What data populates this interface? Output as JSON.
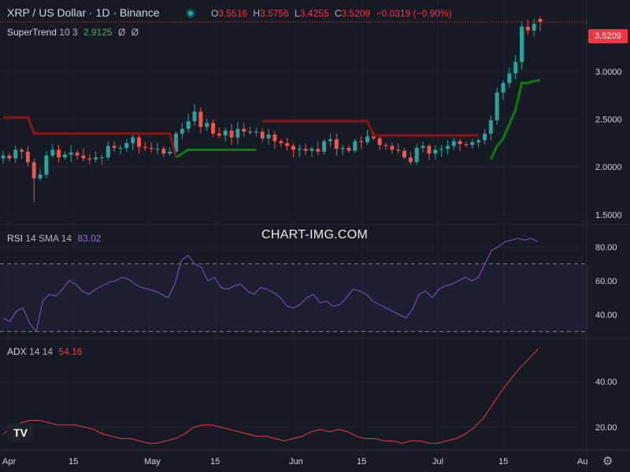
{
  "header": {
    "symbol": "XRP / US Dollar · 1D · Binance",
    "open_label": "O",
    "open": "3.5516",
    "high_label": "H",
    "high": "3.5756",
    "low_label": "L",
    "low": "3.4255",
    "close_label": "C",
    "close": "3.5209",
    "change": "−0.0319 (−0.90%)"
  },
  "supertrend": {
    "label": "SuperTrend",
    "params": "10 3",
    "value": "2.9125"
  },
  "rsi": {
    "label": "RSI",
    "params": "14 SMA 14",
    "value": "83.02"
  },
  "adx": {
    "label": "ADX",
    "params": "14 14",
    "value": "54.16"
  },
  "watermark": "CHART-IMG.COM",
  "price_tag": "3.5209",
  "colors": {
    "up": "#26a69a",
    "down": "#ef5350",
    "supertrend_up": "#087f0c",
    "supertrend_down": "#8e1313",
    "rsi": "#7e57c2",
    "adx": "#f23645",
    "background": "#161a25"
  },
  "chart_data": [
    {
      "type": "candlestick",
      "title": "XRP / US Dollar · 1D · Binance",
      "ylim": [
        1.4,
        3.75
      ],
      "yticks": [
        "1.5000",
        "2.0000",
        "2.5000",
        "3.0000"
      ],
      "xticks": [
        "Apr",
        "15",
        "May",
        "15",
        "Jun",
        "15",
        "Jul",
        "15",
        "Au"
      ],
      "approx_close": [
        2.12,
        2.09,
        2.18,
        2.16,
        2.05,
        1.88,
        1.92,
        2.12,
        2.18,
        2.1,
        2.13,
        2.15,
        2.12,
        2.09,
        2.08,
        2.1,
        2.1,
        2.22,
        2.2,
        2.2,
        2.25,
        2.31,
        2.21,
        2.2,
        2.19,
        2.19,
        2.14,
        2.16,
        2.35,
        2.4,
        2.48,
        2.58,
        2.42,
        2.46,
        2.35,
        2.33,
        2.38,
        2.31,
        2.4,
        2.37,
        2.36,
        2.37,
        2.3,
        2.34,
        2.27,
        2.25,
        2.22,
        2.18,
        2.19,
        2.17,
        2.19,
        2.16,
        2.27,
        2.29,
        2.19,
        2.2,
        2.17,
        2.27,
        2.26,
        2.32,
        2.3,
        2.23,
        2.22,
        2.18,
        2.17,
        2.1,
        2.05,
        2.2,
        2.22,
        2.14,
        2.18,
        2.19,
        2.22,
        2.27,
        2.24,
        2.23,
        2.26,
        2.28,
        2.35,
        2.49,
        2.78,
        2.88,
        2.98,
        3.1,
        3.47,
        3.43,
        3.5,
        3.52
      ],
      "series": [
        {
          "name": "SuperTrend",
          "params": "10 3",
          "last": 2.9125
        }
      ]
    },
    {
      "type": "line",
      "series": [
        {
          "name": "RSI",
          "params": "14 SMA 14",
          "values": [
            38,
            36,
            42,
            44,
            35,
            30,
            48,
            52,
            51,
            55,
            60,
            58,
            54,
            52,
            55,
            57,
            59,
            60,
            62,
            61,
            58,
            56,
            55,
            54,
            52,
            50,
            58,
            72,
            75,
            70,
            68,
            60,
            62,
            56,
            55,
            57,
            58,
            54,
            52,
            56,
            55,
            53,
            50,
            45,
            44,
            46,
            50,
            52,
            47,
            48,
            45,
            46,
            50,
            55,
            54,
            52,
            48,
            46,
            44,
            42,
            40,
            38,
            43,
            52,
            54,
            50,
            55,
            57,
            58,
            60,
            62,
            60,
            62,
            70,
            78,
            80,
            83,
            84,
            85,
            84,
            85,
            83.02
          ],
          "last": 83.02
        }
      ],
      "ylim": [
        27,
        92
      ],
      "yticks": [
        "40.00",
        "60.00",
        "80.00"
      ],
      "bands": [
        30,
        70
      ]
    },
    {
      "type": "line",
      "series": [
        {
          "name": "ADX",
          "params": "14 14",
          "values": [
            17,
            20,
            22,
            23,
            23,
            22,
            21,
            21,
            21,
            20,
            19,
            17,
            16,
            15,
            15,
            14,
            13,
            13,
            14,
            15,
            17,
            20,
            21,
            21,
            20,
            19,
            18,
            17,
            16,
            16,
            15,
            14,
            15,
            16,
            18,
            19,
            18,
            19,
            18,
            16,
            15,
            15,
            14,
            14,
            13,
            14,
            14,
            13,
            13,
            14,
            15,
            17,
            20,
            24,
            30,
            36,
            41,
            46,
            50,
            54.16
          ],
          "last": 54.16
        }
      ],
      "ylim": [
        10,
        58
      ],
      "yticks": [
        "20.00",
        "40.00"
      ]
    }
  ]
}
